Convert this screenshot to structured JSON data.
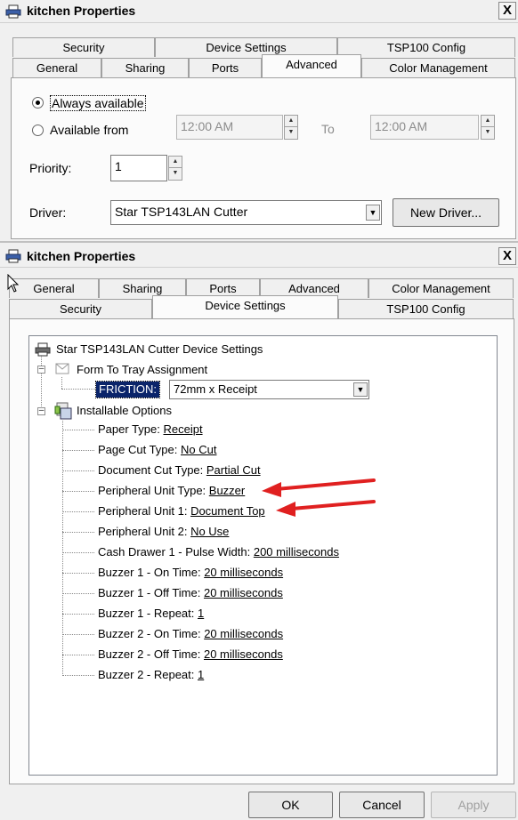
{
  "window1": {
    "title": "kitchen Properties",
    "close": "X",
    "tabs_back": [
      "Security",
      "Device Settings",
      "TSP100 Config"
    ],
    "tabs_front": [
      "General",
      "Sharing",
      "Ports",
      "Advanced",
      "Color Management"
    ],
    "active_tab": "Advanced",
    "always_available": "Always available",
    "available_from": "Available from",
    "time_from": "12:00 AM",
    "to_label": "To",
    "time_to": "12:00 AM",
    "priority_label": "Priority:",
    "priority_value": "1",
    "driver_label": "Driver:",
    "driver_value": "Star TSP143LAN Cutter",
    "new_driver": "New Driver..."
  },
  "window2": {
    "title": "kitchen Properties",
    "close": "X",
    "tabs_back": [
      "General",
      "Sharing",
      "Ports",
      "Advanced",
      "Color Management"
    ],
    "tabs_front": [
      "Security",
      "Device Settings",
      "TSP100 Config"
    ],
    "active_tab": "Device Settings",
    "tree": {
      "root": "Star TSP143LAN Cutter Device Settings",
      "form_to_tray": "Form To Tray Assignment",
      "friction_label": "FRICTION:",
      "friction_value": "72mm x Receipt",
      "installable_options": "Installable Options",
      "options": [
        {
          "label": "Paper Type: ",
          "value": "Receipt"
        },
        {
          "label": "Page Cut Type: ",
          "value": "No Cut"
        },
        {
          "label": "Document Cut Type: ",
          "value": "Partial Cut"
        },
        {
          "label": "Peripheral Unit Type: ",
          "value": "Buzzer"
        },
        {
          "label": "Peripheral Unit 1: ",
          "value": "Document Top"
        },
        {
          "label": "Peripheral Unit 2: ",
          "value": "No Use"
        },
        {
          "label": "Cash Drawer 1 - Pulse Width: ",
          "value": "200 milliseconds"
        },
        {
          "label": "Buzzer 1 - On Time: ",
          "value": "20 milliseconds"
        },
        {
          "label": "Buzzer 1 - Off Time: ",
          "value": "20 milliseconds"
        },
        {
          "label": "Buzzer 1 - Repeat: ",
          "value": "1"
        },
        {
          "label": "Buzzer 2 - On Time: ",
          "value": "20 milliseconds"
        },
        {
          "label": "Buzzer 2 - Off Time: ",
          "value": "20 milliseconds"
        },
        {
          "label": "Buzzer 2 - Repeat: ",
          "value": "1"
        }
      ]
    },
    "buttons": {
      "ok": "OK",
      "cancel": "Cancel",
      "apply": "Apply"
    }
  },
  "colors": {
    "annotation_arrow": "#e02020",
    "selection": "#0a246a"
  }
}
